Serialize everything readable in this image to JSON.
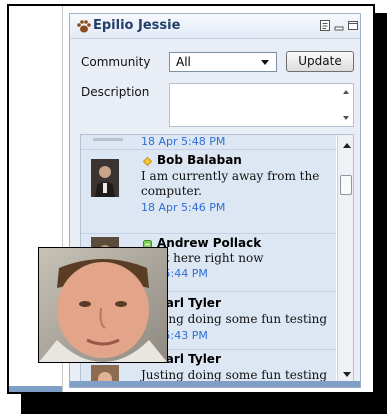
{
  "panel": {
    "title": "Epilio Jessie",
    "title_icon": "paw-icon"
  },
  "form": {
    "community_label": "Community",
    "community_value": "All",
    "update_label": "Update",
    "description_label": "Description"
  },
  "messages": [
    {
      "name": "",
      "text": "",
      "time": "18 Apr 5:48 PM",
      "status": "none"
    },
    {
      "name": "Bob Balaban",
      "text": "I am currently away from the computer.",
      "time": "18 Apr 5:46 PM",
      "status": "away"
    },
    {
      "name": "Andrew Pollack",
      "text": "I not here right now",
      "time": "Apr 5:44 PM",
      "status": "online"
    },
    {
      "name": "Carl Tyler",
      "text": "Justing doing some fun testing",
      "time": "Apr 5:43 PM",
      "status": "none"
    },
    {
      "name": "Carl Tyler",
      "text": "Justing doing some fun testing",
      "time": "",
      "status": "none"
    }
  ],
  "colors": {
    "title_text": "#243f6a",
    "time_text": "#2f6fd1",
    "list_bg": "#dde6f3",
    "accent_blue": "#7f9fc6"
  }
}
